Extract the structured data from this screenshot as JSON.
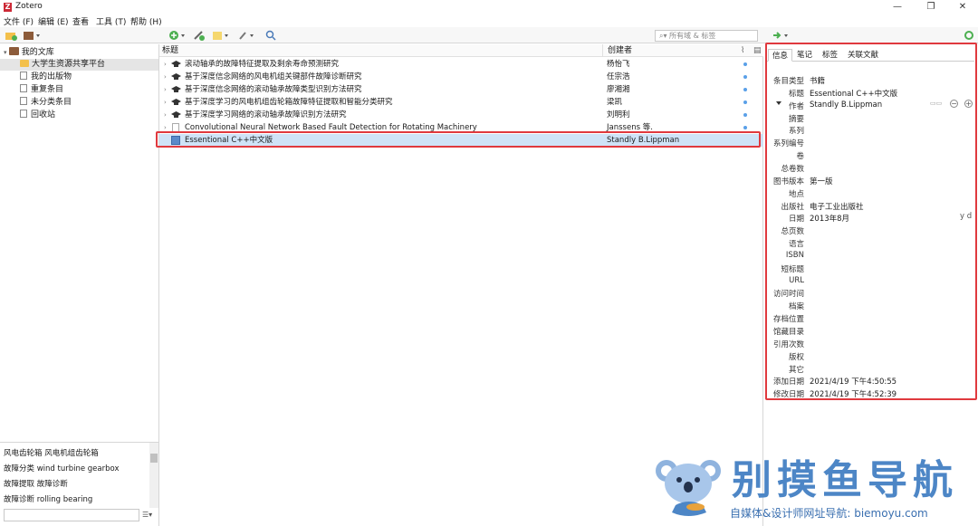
{
  "window": {
    "title": "Zotero",
    "icon_letter": "Z",
    "controls": [
      "—",
      "❐",
      "✕"
    ]
  },
  "menu": [
    "文件 (F)",
    "编辑 (E)",
    "查看",
    "工具 (T)",
    "帮助 (H)"
  ],
  "toolbar": {
    "search_placeholder": "所有域 & 标签"
  },
  "library": {
    "root": "我的文库",
    "items": [
      {
        "label": "大学生资源共享平台",
        "icon": "folder-icon",
        "selected": true
      },
      {
        "label": "我的出版物",
        "icon": "doc-icon"
      },
      {
        "label": "重复条目",
        "icon": "doc-icon"
      },
      {
        "label": "未分类条目",
        "icon": "doc-icon"
      },
      {
        "label": "回收站",
        "icon": "trash-icon"
      }
    ]
  },
  "tags": {
    "rows": [
      "风电齿轮箱   风电机组齿轮箱",
      "故障分类 wind turbine gearbox",
      "故障提取   故障诊断",
      "故障诊断 rolling bearing"
    ]
  },
  "items_table": {
    "col_title": "标题",
    "col_creator": "创建者",
    "rows": [
      {
        "title": "滚动轴承的故障特征提取及剩余寿命预测研究",
        "creator": "杨怡飞",
        "type": "thesis"
      },
      {
        "title": "基于深度信念网络的风电机组关键部件故障诊断研究",
        "creator": "任宗浩",
        "type": "thesis"
      },
      {
        "title": "基于深度信念网络的滚动轴承故障类型识别方法研究",
        "creator": "廖湘湘",
        "type": "thesis"
      },
      {
        "title": "基于深度学习的风电机组齿轮箱故障特征提取和智能分类研究",
        "creator": "梁凯",
        "type": "thesis"
      },
      {
        "title": "基于深度学习网络的滚动轴承故障识别方法研究",
        "creator": "刘明利",
        "type": "thesis"
      },
      {
        "title": "Convolutional Neural Network Based Fault Detection for Rotating Machinery",
        "creator": "Janssens 等.",
        "type": "article"
      },
      {
        "title": "Essentional C++中文版",
        "creator": "Standly B.Lippman",
        "type": "book",
        "selected": true
      }
    ]
  },
  "info_pane": {
    "tabs": [
      "信息",
      "笔记",
      "标签",
      "关联文献"
    ],
    "fields": [
      {
        "label": "条目类型",
        "value": "书籍"
      },
      {
        "label": "标题",
        "value": "Essentional C++中文版"
      },
      {
        "label": "作者",
        "value": "Standly B.Lippman"
      },
      {
        "label": "摘要",
        "value": ""
      },
      {
        "label": "系列",
        "value": ""
      },
      {
        "label": "系列编号",
        "value": ""
      },
      {
        "label": "卷",
        "value": ""
      },
      {
        "label": "总卷数",
        "value": ""
      },
      {
        "label": "图书版本",
        "value": "第一版"
      },
      {
        "label": "地点",
        "value": ""
      },
      {
        "label": "出版社",
        "value": "电子工业出版社"
      },
      {
        "label": "日期",
        "value": "2013年8月"
      },
      {
        "label": "总页数",
        "value": ""
      },
      {
        "label": "语言",
        "value": ""
      },
      {
        "label": "ISBN",
        "value": ""
      },
      {
        "label": "短标题",
        "value": ""
      },
      {
        "label": "URL",
        "value": ""
      },
      {
        "label": "访问时间",
        "value": ""
      },
      {
        "label": "档案",
        "value": ""
      },
      {
        "label": "存档位置",
        "value": ""
      },
      {
        "label": "馆藏目录",
        "value": ""
      },
      {
        "label": "引用次数",
        "value": ""
      },
      {
        "label": "版权",
        "value": ""
      },
      {
        "label": "其它",
        "value": ""
      },
      {
        "label": "添加日期",
        "value": "2021/4/19 下午4:50:55"
      },
      {
        "label": "修改日期",
        "value": "2021/4/19 下午4:52:39"
      }
    ],
    "date_hint": "y d"
  },
  "watermark": {
    "title": "别摸鱼导航",
    "subtitle": "自媒体&设计师网址导航: biemoyu.com"
  },
  "colors": {
    "highlight": "#e0393e",
    "selection": "#cfe3f7",
    "brand": "#4d86c6"
  }
}
